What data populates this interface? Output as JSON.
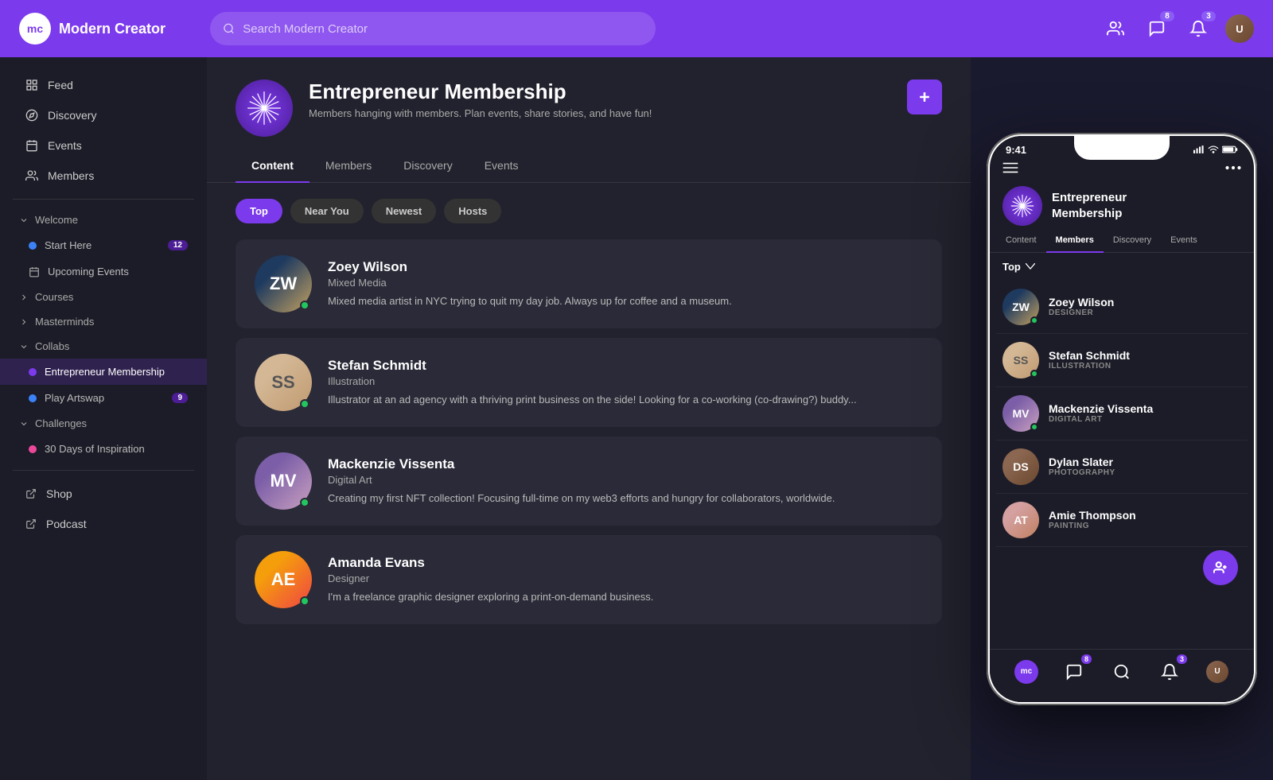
{
  "app": {
    "name": "Modern Creator",
    "search_placeholder": "Search Modern Creator"
  },
  "nav": {
    "badges": {
      "messages": "8",
      "notifications": "3"
    }
  },
  "sidebar": {
    "nav_items": [
      {
        "id": "feed",
        "label": "Feed",
        "icon": "grid"
      },
      {
        "id": "discovery",
        "label": "Discovery",
        "icon": "compass"
      },
      {
        "id": "events",
        "label": "Events",
        "icon": "calendar"
      },
      {
        "id": "members",
        "label": "Members",
        "icon": "users"
      }
    ],
    "sections": [
      {
        "label": "Welcome",
        "children": [
          {
            "id": "start-here",
            "label": "Start Here",
            "badge": "12",
            "dot": "blue"
          },
          {
            "id": "upcoming-events",
            "label": "Upcoming Events",
            "dot": null
          }
        ]
      },
      {
        "label": "Courses",
        "children": []
      },
      {
        "label": "Masterminds",
        "children": []
      },
      {
        "label": "Collabs",
        "children": [
          {
            "id": "entrepreneur-membership",
            "label": "Entrepreneur Membership",
            "active": true,
            "dot": "purple"
          },
          {
            "id": "play-artswap",
            "label": "Play Artswap",
            "badge": "9",
            "dot": "blue"
          }
        ]
      },
      {
        "label": "Challenges",
        "children": [
          {
            "id": "30-days",
            "label": "30 Days of Inspiration",
            "dot": "pink"
          }
        ]
      }
    ],
    "footer": [
      {
        "id": "shop",
        "label": "Shop"
      },
      {
        "id": "podcast",
        "label": "Podcast"
      }
    ]
  },
  "group": {
    "title": "Entrepreneur Membership",
    "description": "Members hanging with members. Plan events, share stories, and have fun!",
    "tabs": [
      "Content",
      "Members",
      "Discovery",
      "Events"
    ],
    "active_tab": "Members",
    "filter_pills": [
      "Top",
      "Near You",
      "Newest",
      "Hosts"
    ],
    "active_pill": "Top"
  },
  "members": [
    {
      "name": "Zoey Wilson",
      "role": "Mixed Media",
      "bio": "Mixed media artist in NYC trying to quit my day job. Always up for coffee and a museum.",
      "online": true,
      "color1": "#1e3a5f",
      "color2": "#c2a060",
      "initials": "ZW",
      "phone_role": "DESIGNER"
    },
    {
      "name": "Stefan Schmidt",
      "role": "Illustration",
      "bio": "Illustrator at an ad agency with a thriving print business on the side! Looking for a co-working (co-drawing?) buddy...",
      "online": true,
      "color1": "#d4b896",
      "color2": "#c09a70",
      "initials": "SS",
      "phone_role": "ILLUSTRATION"
    },
    {
      "name": "Mackenzie Vissenta",
      "role": "Digital Art",
      "bio": "Creating my first NFT collection! Focusing full-time on my web3 efforts and hungry for collaborators, worldwide.",
      "online": true,
      "color1": "#7b5ea7",
      "color2": "#c9a0c0",
      "initials": "MV",
      "phone_role": "DIGITAL ART"
    },
    {
      "name": "Amanda Evans",
      "role": "Designer",
      "bio": "I'm a freelance graphic designer exploring a print-on-demand business.",
      "online": true,
      "color1": "#f59e0b",
      "color2": "#ef4444",
      "initials": "AE",
      "phone_role": "DESIGNER"
    }
  ],
  "phone": {
    "time": "9:41",
    "group_title": "Entrepreneur\nMembership",
    "tabs": [
      "Content",
      "Members",
      "Discovery",
      "Events"
    ],
    "active_tab": "Members",
    "filter": "Top",
    "members": [
      {
        "name": "Zoey Wilson",
        "role": "DESIGNER",
        "color1": "#1e3a5f",
        "color2": "#c2a060",
        "online": true
      },
      {
        "name": "Stefan Schmidt",
        "role": "ILLUSTRATION",
        "color1": "#d4b896",
        "color2": "#c09a70",
        "online": true
      },
      {
        "name": "Mackenzie Vissenta",
        "role": "DIGITAL ART",
        "color1": "#7b5ea7",
        "color2": "#c9a0c0",
        "online": true
      },
      {
        "name": "Dylan Slater",
        "role": "PHOTOGRAPHY",
        "color1": "#8b6650",
        "color2": "#6b4830",
        "online": false
      },
      {
        "name": "Amie Thompson",
        "role": "PAINTING",
        "color1": "#d4a0a0",
        "color2": "#c08060",
        "online": false
      }
    ],
    "badges": {
      "messages": "8",
      "notifications": "3"
    }
  }
}
